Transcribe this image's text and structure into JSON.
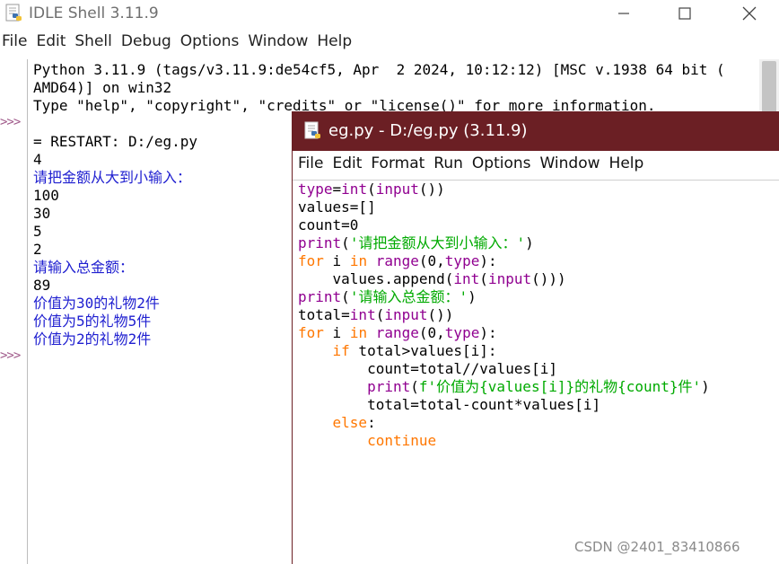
{
  "shell": {
    "title": "IDLE Shell 3.11.9",
    "menu": [
      "File",
      "Edit",
      "Shell",
      "Debug",
      "Options",
      "Window",
      "Help"
    ],
    "prompt": ">>>",
    "lines": [
      {
        "text": "Python 3.11.9 (tags/v3.11.9:de54cf5, Apr  2 2024, 10:12:12) [MSC v.1938 64 bit (",
        "color": "black"
      },
      {
        "text": "AMD64)] on win32",
        "color": "black"
      },
      {
        "text": "Type \"help\", \"copyright\", \"credits\" or \"license()\" for more information.",
        "color": "black"
      },
      {
        "text": "",
        "color": "black"
      },
      {
        "text": "= RESTART: D:/eg.py",
        "color": "black"
      },
      {
        "text": "4",
        "color": "black"
      },
      {
        "text": "请把金额从大到小输入：",
        "color": "blue"
      },
      {
        "text": "100",
        "color": "black"
      },
      {
        "text": "30",
        "color": "black"
      },
      {
        "text": "5",
        "color": "black"
      },
      {
        "text": "2",
        "color": "black"
      },
      {
        "text": "请输入总金额：",
        "color": "blue"
      },
      {
        "text": "89",
        "color": "black"
      },
      {
        "text": "价值为30的礼物2件",
        "color": "blue"
      },
      {
        "text": "价值为5的礼物5件",
        "color": "blue"
      },
      {
        "text": "价值为2的礼物2件",
        "color": "blue"
      }
    ]
  },
  "editor": {
    "title": "eg.py - D:/eg.py (3.11.9)",
    "menu": [
      "File",
      "Edit",
      "Format",
      "Run",
      "Options",
      "Window",
      "Help"
    ],
    "code_lines": [
      [
        {
          "t": "type",
          "c": "bi"
        },
        {
          "t": "=",
          "c": "cs"
        },
        {
          "t": "int",
          "c": "bi"
        },
        {
          "t": "(",
          "c": "cs"
        },
        {
          "t": "input",
          "c": "bi"
        },
        {
          "t": "())",
          "c": "cs"
        }
      ],
      [
        {
          "t": "values=[]",
          "c": "cs"
        }
      ],
      [
        {
          "t": "count=0",
          "c": "cs"
        }
      ],
      [
        {
          "t": "print",
          "c": "bi"
        },
        {
          "t": "(",
          "c": "cs"
        },
        {
          "t": "'请把金额从大到小输入：'",
          "c": "str"
        },
        {
          "t": ")",
          "c": "cs"
        }
      ],
      [
        {
          "t": "for",
          "c": "kw"
        },
        {
          "t": " i ",
          "c": "cs"
        },
        {
          "t": "in",
          "c": "kw"
        },
        {
          "t": " ",
          "c": "cs"
        },
        {
          "t": "range",
          "c": "bi"
        },
        {
          "t": "(0,",
          "c": "cs"
        },
        {
          "t": "type",
          "c": "bi"
        },
        {
          "t": "):",
          "c": "cs"
        }
      ],
      [
        {
          "t": "    values.append(",
          "c": "cs"
        },
        {
          "t": "int",
          "c": "bi"
        },
        {
          "t": "(",
          "c": "cs"
        },
        {
          "t": "input",
          "c": "bi"
        },
        {
          "t": "()))",
          "c": "cs"
        }
      ],
      [
        {
          "t": "print",
          "c": "bi"
        },
        {
          "t": "(",
          "c": "cs"
        },
        {
          "t": "'请输入总金额：'",
          "c": "str"
        },
        {
          "t": ")",
          "c": "cs"
        }
      ],
      [
        {
          "t": "total=",
          "c": "cs"
        },
        {
          "t": "int",
          "c": "bi"
        },
        {
          "t": "(",
          "c": "cs"
        },
        {
          "t": "input",
          "c": "bi"
        },
        {
          "t": "())",
          "c": "cs"
        }
      ],
      [
        {
          "t": "for",
          "c": "kw"
        },
        {
          "t": " i ",
          "c": "cs"
        },
        {
          "t": "in",
          "c": "kw"
        },
        {
          "t": " ",
          "c": "cs"
        },
        {
          "t": "range",
          "c": "bi"
        },
        {
          "t": "(0,",
          "c": "cs"
        },
        {
          "t": "type",
          "c": "bi"
        },
        {
          "t": "):",
          "c": "cs"
        }
      ],
      [
        {
          "t": "    ",
          "c": "cs"
        },
        {
          "t": "if",
          "c": "kw"
        },
        {
          "t": " total>values[i]:",
          "c": "cs"
        }
      ],
      [
        {
          "t": "        count=total//values[i]",
          "c": "cs"
        }
      ],
      [
        {
          "t": "        ",
          "c": "cs"
        },
        {
          "t": "print",
          "c": "bi"
        },
        {
          "t": "(",
          "c": "cs"
        },
        {
          "t": "f'价值为{values[i]}的礼物{count}件'",
          "c": "str"
        },
        {
          "t": ")",
          "c": "cs"
        }
      ],
      [
        {
          "t": "        total=total-count*values[i]",
          "c": "cs"
        }
      ],
      [
        {
          "t": "    ",
          "c": "cs"
        },
        {
          "t": "else",
          "c": "kw"
        },
        {
          "t": ":",
          "c": "cs"
        }
      ],
      [
        {
          "t": "        ",
          "c": "cs"
        },
        {
          "t": "continue",
          "c": "kw"
        }
      ]
    ]
  },
  "watermark": "CSDN @2401_83410866",
  "colors": {
    "editor_titlebar": "#6b1f24",
    "keyword": "#ff7700",
    "builtin": "#900090",
    "string": "#00aa00",
    "shell_output": "#2020d0",
    "prompt": "#a05a8a"
  },
  "icons": {
    "app": "python-idle-icon",
    "minimize": "minimize-icon",
    "maximize": "maximize-icon",
    "close": "close-icon"
  }
}
